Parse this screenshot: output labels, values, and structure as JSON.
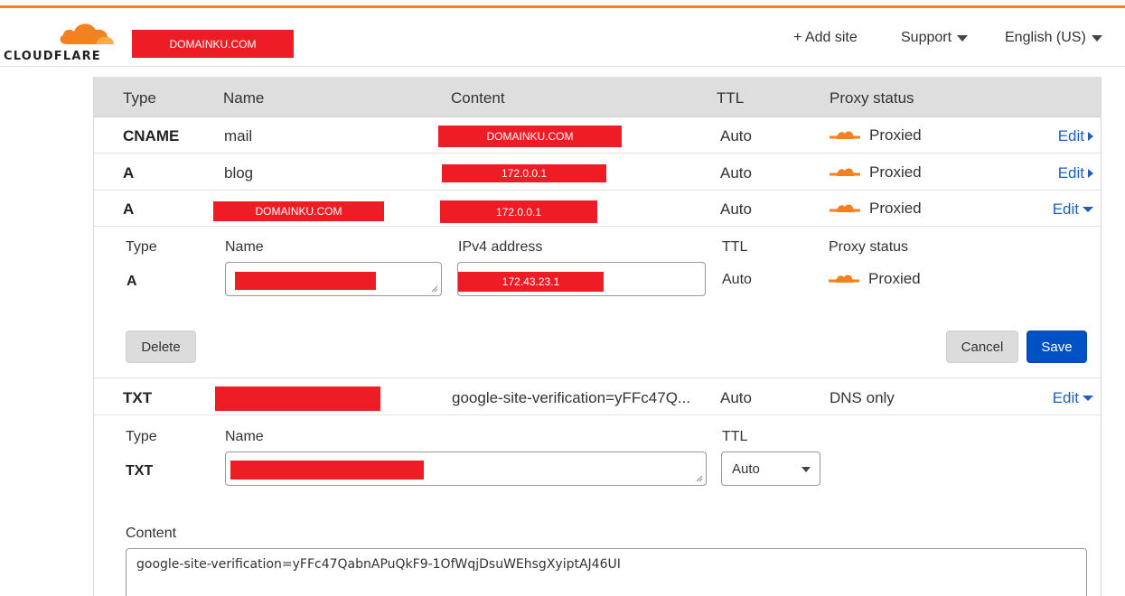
{
  "colors": {
    "brand": "#f48120",
    "redaction": "#ee1c25",
    "link": "#1f5fb7",
    "primary": "#0051c3"
  },
  "header": {
    "logo_text": "CLOUDFLARE",
    "domain": "DOMAINKU.COM",
    "add_site": "+ Add site",
    "support": "Support",
    "language": "English (US)"
  },
  "table": {
    "columns": {
      "type": "Type",
      "name": "Name",
      "content": "Content",
      "ttl": "TTL",
      "proxy": "Proxy status"
    },
    "rows": [
      {
        "type": "CNAME",
        "name": "mail",
        "content": "DOMAINKU.COM",
        "ttl": "Auto",
        "proxy": "Proxied",
        "edit": "Edit"
      },
      {
        "type": "A",
        "name": "blog",
        "content": "172.0.0.1",
        "ttl": "Auto",
        "proxy": "Proxied",
        "edit": "Edit"
      },
      {
        "type": "A",
        "name": "DOMAINKU.COM",
        "content": "172.0.0.1",
        "ttl": "Auto",
        "proxy": "Proxied",
        "edit": "Edit"
      },
      {
        "type": "TXT",
        "name": "",
        "content": "google-site-verification=yFFc47Q...",
        "ttl": "Auto",
        "proxy": "DNS only",
        "edit": "Edit"
      }
    ]
  },
  "edit_a": {
    "type_label": "Type",
    "type_value": "A",
    "name_label": "Name",
    "ipv4_label": "IPv4 address",
    "ipv4_value": "172.43.23.1",
    "ttl_label": "TTL",
    "ttl_value": "Auto",
    "proxy_label": "Proxy status",
    "proxy_value": "Proxied",
    "delete": "Delete",
    "cancel": "Cancel",
    "save": "Save"
  },
  "edit_txt": {
    "type_label": "Type",
    "type_value": "TXT",
    "name_label": "Name",
    "ttl_label": "TTL",
    "ttl_value": "Auto",
    "content_label": "Content",
    "content_value": "google-site-verification=yFFc47QabnAPuQkF9-1OfWqjDsuWEhsgXyiptAJ46UI"
  }
}
